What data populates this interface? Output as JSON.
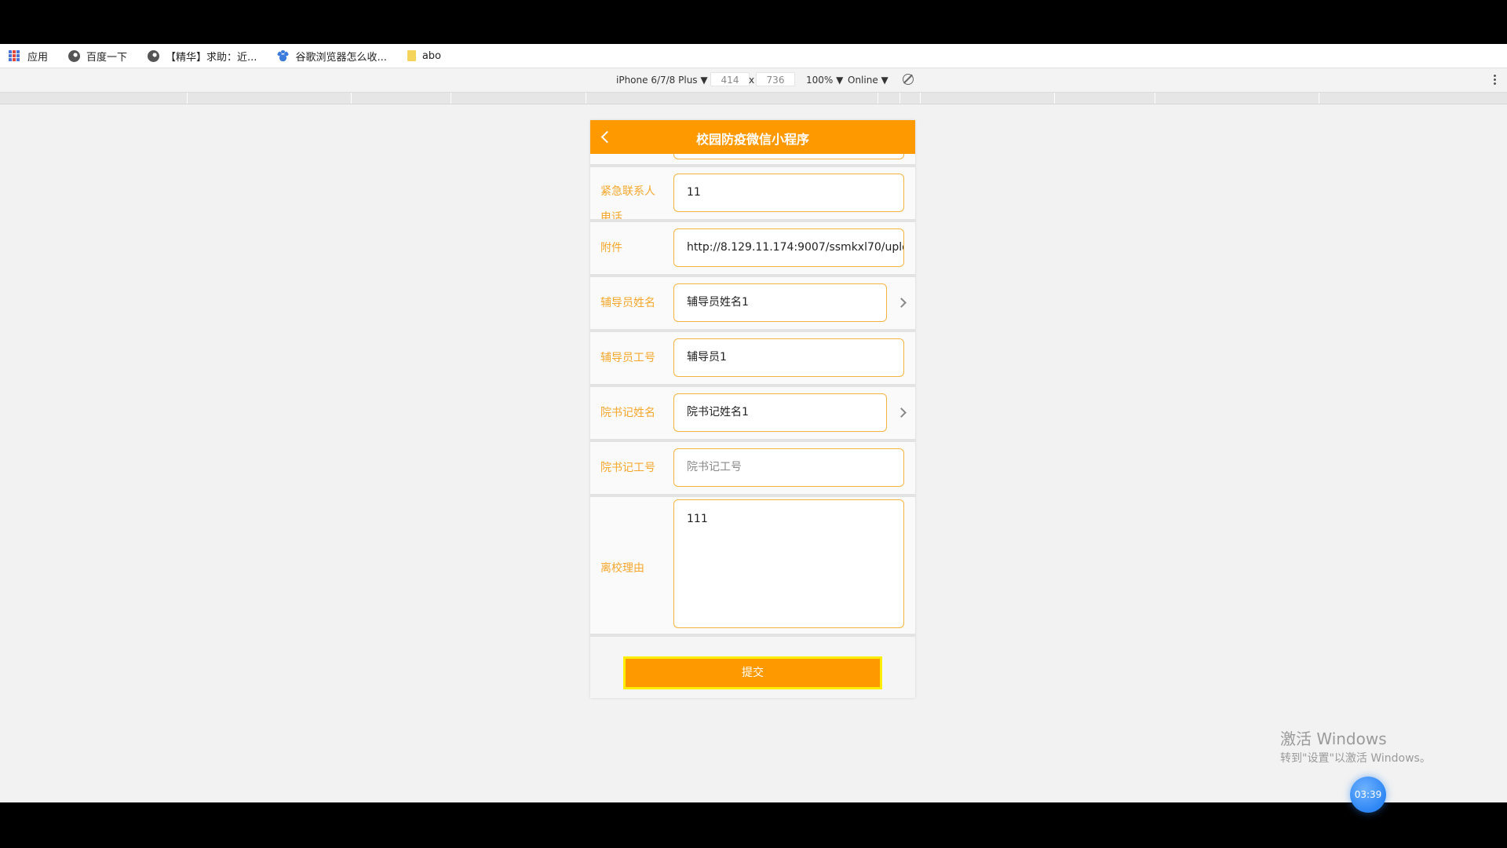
{
  "bookmarks": [
    {
      "label": "应用",
      "icon": "apps-grid-icon"
    },
    {
      "label": "百度一下",
      "icon": "globe-icon"
    },
    {
      "label": "【精华】求助：近...",
      "icon": "globe-icon"
    },
    {
      "label": "谷歌浏览器怎么收...",
      "icon": "baidu-paw-icon"
    },
    {
      "label": "abo",
      "icon": "folder-icon"
    }
  ],
  "device_toolbar": {
    "device": "iPhone 6/7/8 Plus ▼",
    "width": "414",
    "times": "x",
    "height": "736",
    "zoom": "100% ▼",
    "network": "Online ▼"
  },
  "app": {
    "title": "校园防疫微信小程序",
    "fields": {
      "emergency_phone": {
        "label": "紧急联系人电话",
        "value": "11"
      },
      "attachment": {
        "label": "附件",
        "value": "http://8.129.11.174:9007/ssmkxl70/uplo"
      },
      "counselor_name": {
        "label": "辅导员姓名",
        "value": "辅导员姓名1"
      },
      "counselor_id": {
        "label": "辅导员工号",
        "value": "辅导员1"
      },
      "secretary_name": {
        "label": "院书记姓名",
        "value": "院书记姓名1"
      },
      "secretary_id": {
        "label": "院书记工号",
        "placeholder": "院书记工号"
      },
      "leave_reason": {
        "label": "离校理由",
        "value": "111"
      }
    },
    "submit_label": "提交",
    "accent_color": "#ff9900",
    "label_color": "#f5a72b"
  },
  "watermark": {
    "title": "激活 Windows",
    "subtitle": "转到\"设置\"以激活 Windows。"
  },
  "clock": "03:39"
}
